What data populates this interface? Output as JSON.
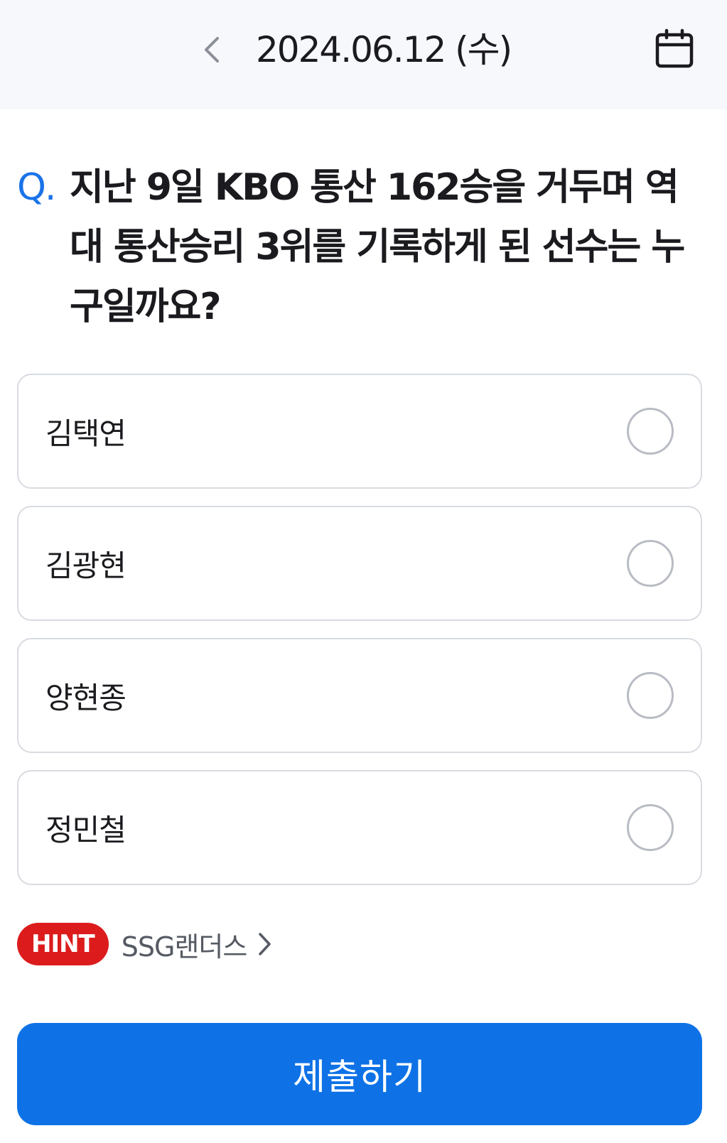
{
  "header": {
    "date": "2024.06.12 (수)",
    "back_icon": "chevron-left-icon",
    "calendar_icon": "calendar-icon"
  },
  "question": {
    "prefix": "Q.",
    "text": "지난 9일 KBO 통산 162승을 거두며 역대 통산승리 3위를 기록하게 된 선수는 누구일까요?"
  },
  "options": [
    {
      "label": "김택연",
      "selected": false
    },
    {
      "label": "김광현",
      "selected": false
    },
    {
      "label": "양현종",
      "selected": false
    },
    {
      "label": "정민철",
      "selected": false
    }
  ],
  "hint": {
    "badge": "HINT",
    "text": "SSG랜더스",
    "icon": "chevron-right-icon"
  },
  "submit": {
    "label": "제출하기"
  },
  "colors": {
    "accent": "#0e72e6",
    "question_prefix": "#1a73e8",
    "hint_badge": "#dc1c1c",
    "header_bg": "#f7f8fc"
  }
}
